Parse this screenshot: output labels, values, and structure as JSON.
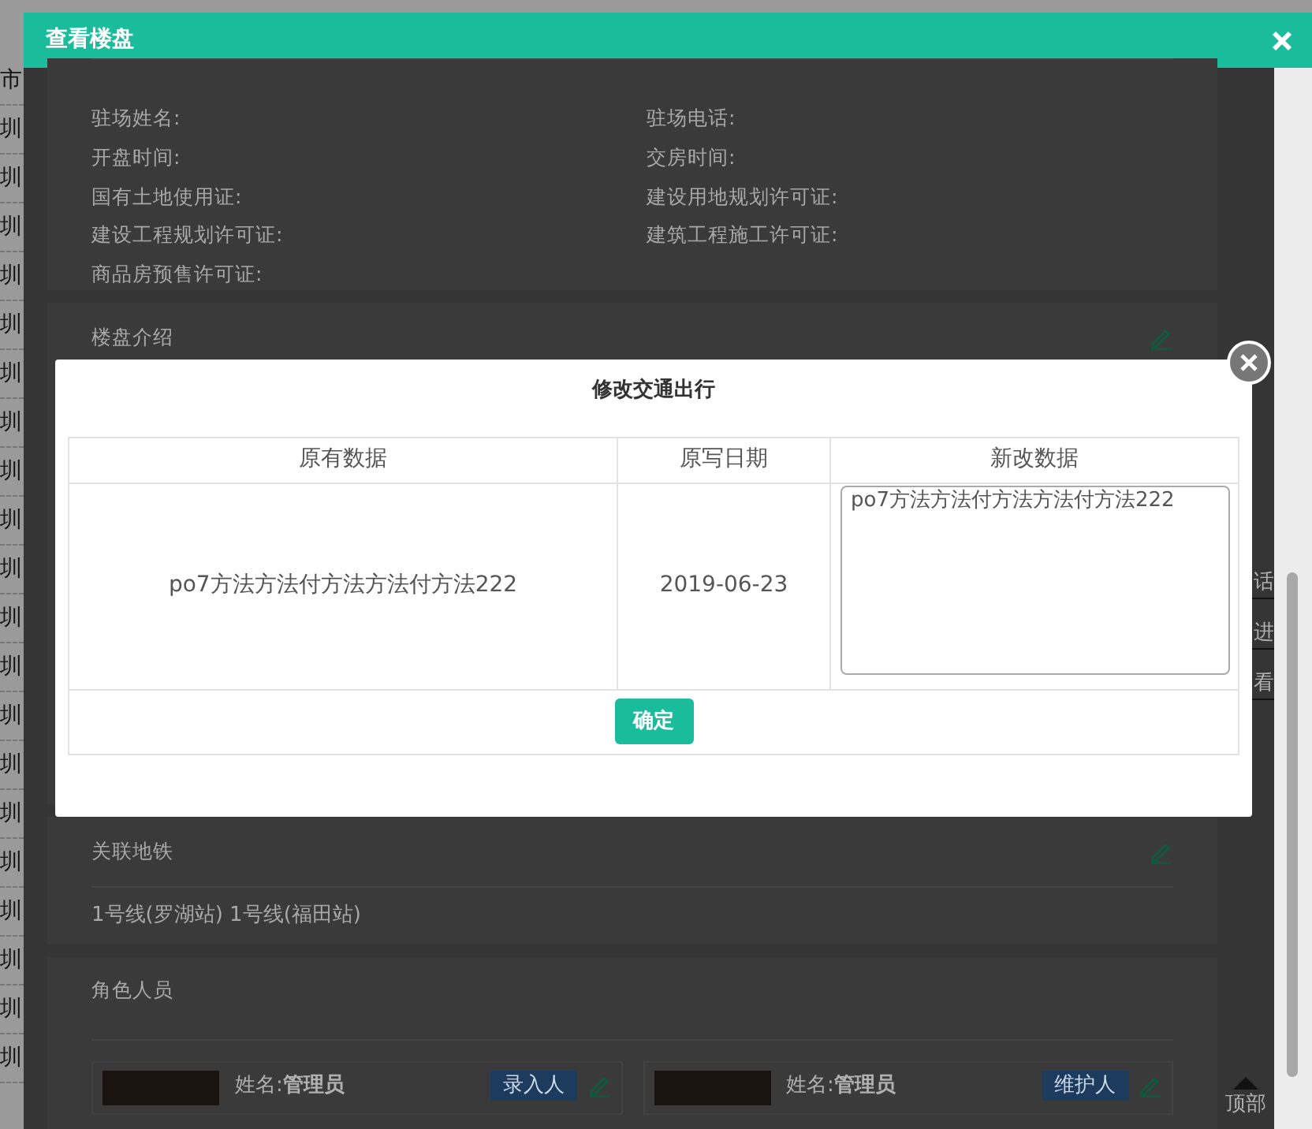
{
  "background_page": {
    "side_cells": [
      "市",
      "圳",
      "圳",
      "圳",
      "圳",
      "圳",
      "圳",
      "圳",
      "圳",
      "圳",
      "圳",
      "圳",
      "圳",
      "圳",
      "圳",
      "圳",
      "圳",
      "圳",
      "圳",
      "圳",
      "圳"
    ]
  },
  "outer_dialog": {
    "title": "查看楼盘",
    "developer_fields": [
      {
        "label": "驻场姓名:"
      },
      {
        "label": "驻场电话:"
      },
      {
        "label": "开盘时间:"
      },
      {
        "label": "交房时间:"
      },
      {
        "label": "国有土地使用证:"
      },
      {
        "label": "建设用地规划许可证:"
      },
      {
        "label": "建设工程规划许可证:"
      },
      {
        "label": "建筑工程施工许可证:"
      },
      {
        "label": "商品房预售许可证:"
      }
    ],
    "intro": {
      "title": "楼盘介绍"
    },
    "metro": {
      "title": "关联地铁",
      "value": "1号线(罗湖站) 1号线(福田站)"
    },
    "staff": {
      "title": "角色人员",
      "people": [
        {
          "name_label": "姓名:",
          "name": "管理员",
          "role": "录入人"
        },
        {
          "name_label": "姓名:",
          "name": "管理员",
          "role": "维护人"
        }
      ]
    },
    "side_tools": [
      "话",
      "进",
      "看"
    ],
    "back_to_top": "顶部"
  },
  "edit_dialog": {
    "title": "修改交通出行",
    "columns": [
      "原有数据",
      "原写日期",
      "新改数据"
    ],
    "row": {
      "original": "po7方法方法付方法方法付方法222",
      "date": "2019-06-23",
      "new_value": "po7方法方法付方法方法付方法222"
    },
    "confirm": "确定"
  }
}
